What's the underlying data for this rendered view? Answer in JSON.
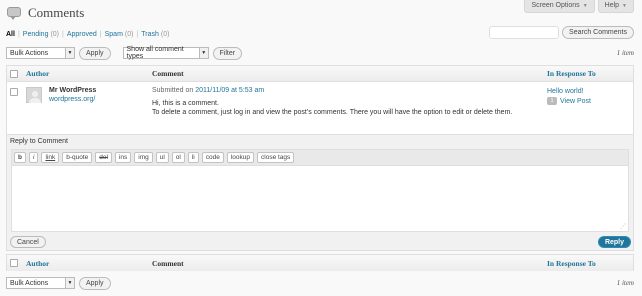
{
  "header": {
    "title": "Comments",
    "screen_options_label": "Screen Options",
    "help_label": "Help"
  },
  "filters": [
    {
      "label": "All",
      "count": ""
    },
    {
      "label": "Pending",
      "count": "(0)"
    },
    {
      "label": "Approved",
      "count": ""
    },
    {
      "label": "Spam",
      "count": "(0)"
    },
    {
      "label": "Trash",
      "count": "(0)"
    }
  ],
  "search": {
    "placeholder": "",
    "button_label": "Search Comments"
  },
  "tablenav_top": {
    "bulk_actions": "Bulk Actions",
    "apply_label": "Apply",
    "type_filter": "Show all comment types",
    "filter_label": "Filter",
    "count": "1 item"
  },
  "table": {
    "columns": {
      "author": "Author",
      "comment": "Comment",
      "response": "In Response To"
    },
    "rows": [
      {
        "author_name": "Mr WordPress",
        "author_url": "wordpress.org/",
        "submitted_prefix": "Submitted on",
        "submitted_date": "2011/11/09 at 5:53 am",
        "lines": [
          "Hi, this is a comment.",
          "To delete a comment, just log in and view the post's comments. There you will have the option to edit or delete them."
        ],
        "response_title": "Hello world!",
        "response_count": "1",
        "view_post": "View Post"
      }
    ]
  },
  "reply": {
    "heading": "Reply to Comment",
    "toolbar": [
      "b",
      "i",
      "link",
      "b-quote",
      "del",
      "ins",
      "img",
      "ul",
      "ol",
      "li",
      "code",
      "lookup",
      "close tags"
    ],
    "cancel_label": "Cancel",
    "reply_label": "Reply"
  },
  "tablenav_bottom": {
    "bulk_actions": "Bulk Actions",
    "apply_label": "Apply",
    "count": "1 item"
  }
}
